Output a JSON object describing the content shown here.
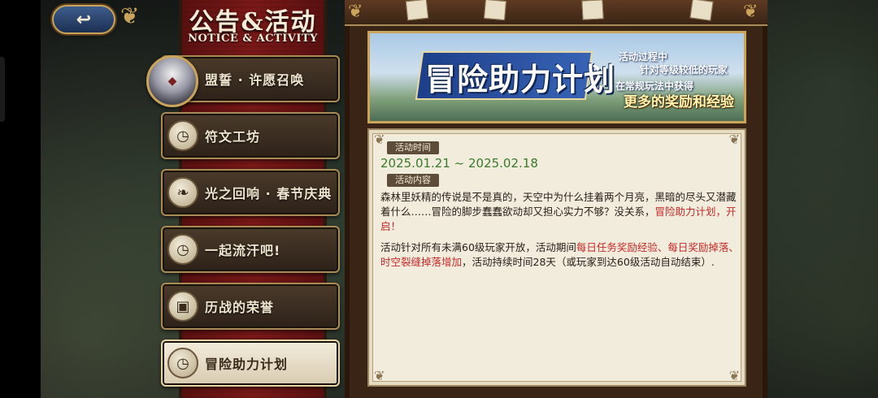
{
  "header": {
    "title_cn": "公告&活动",
    "title_en": "NOTICE & ACTIVITY",
    "back_label": "↩"
  },
  "nav": {
    "items": [
      {
        "label": "盟誓 · 许愿召唤",
        "icon": "character-portrait"
      },
      {
        "label": "符文工坊",
        "icon": "pocket-watch-icon"
      },
      {
        "label": "光之回响 · 春节庆典",
        "icon": "leaf-icon"
      },
      {
        "label": "一起流汗吧!",
        "icon": "pocket-watch-icon"
      },
      {
        "label": "历战的荣誉",
        "icon": "gift-icon"
      },
      {
        "label": "冒险助力计划",
        "icon": "pocket-watch-icon"
      }
    ],
    "selected_index": 5
  },
  "banner": {
    "title": "冒险助力计划",
    "note_line1": "活动过程中",
    "note_line2": "针对等级较低的玩家",
    "note_line3": "在常规玩法中获得",
    "note_line4": "更多的奖励和经验"
  },
  "detail": {
    "time_tag": "活动时间",
    "date_range": "2025.01.21 ~ 2025.02.18",
    "content_tag": "活动内容",
    "p1_a": "森林里妖精的传说是不是真的，天空中为什么挂着两个月亮，黑暗的尽头又潜藏着什么……冒险的脚步蠢蠢欲动却又担心实力不够？没关系，",
    "p1_b": "冒险助力计划，开启！",
    "p2_a": "活动针对所有未满60级玩家开放，活动期间",
    "p2_b": "每日任务奖励经验、每日奖励掉落、时空裂缝掉落增加",
    "p2_c": "，活动持续时间28天（或玩家到达60级活动自动结束）."
  },
  "colors": {
    "ribbon": "#7a1818",
    "gold": "#c9a45a",
    "date_green": "#3a7a2a",
    "highlight_red": "#c42a2a"
  }
}
